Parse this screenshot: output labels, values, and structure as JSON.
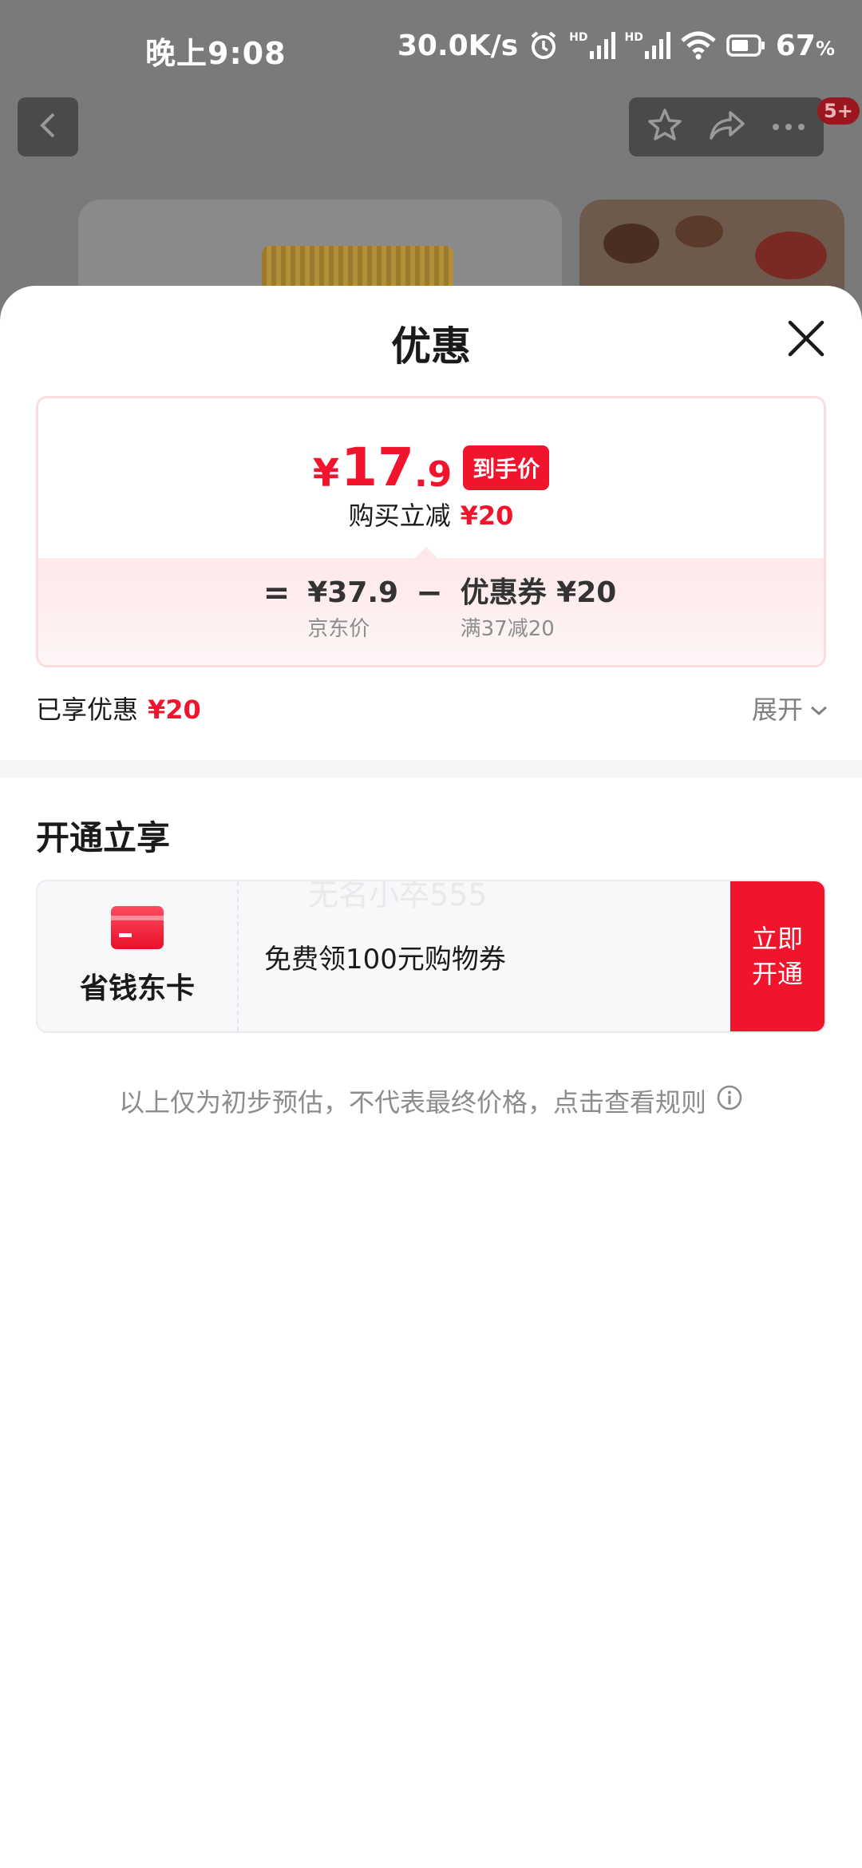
{
  "status_bar": {
    "time": "晚上9:08",
    "network_speed": "30.0K/s",
    "signal_tag_1": "HD",
    "signal_tag_2": "HD",
    "battery_percent": "67",
    "battery_unit": "%",
    "battery_level": 0.67
  },
  "top_nav": {
    "badge": "5+"
  },
  "sheet": {
    "title": "优惠",
    "price_card": {
      "currency": "¥",
      "price_int": "17",
      "price_dec": ".9",
      "final_price_tag": "到手价",
      "discount_label": "购买立减",
      "discount_amount": "¥20",
      "equals": "=",
      "minus": "−",
      "original_price": "¥37.9",
      "original_label": "京东价",
      "coupon_value": "优惠券 ¥20",
      "coupon_condition": "满37减20"
    },
    "enjoyed_label": "已享优惠",
    "enjoyed_amount": "¥20",
    "expand_label": "展开",
    "open_section_title": "开通立享",
    "membership": {
      "name": "省钱东卡",
      "offer": "免费领100元购物券",
      "button_label": "立即开通",
      "watermark": "无名小卒555"
    },
    "disclaimer": "以上仅为初步预估，不代表最终价格，点击查看规则"
  },
  "colors": {
    "accent_red": "#f0142d",
    "card_border": "#fbdde0",
    "muted_text": "#8c8c8c"
  },
  "icons": {
    "back": "chevron-left-icon",
    "favorite": "star-icon",
    "share": "share-icon",
    "more": "more-icon",
    "close": "close-icon",
    "expand": "chevron-down-icon",
    "card": "card-icon",
    "info": "info-icon",
    "alarm": "alarm-icon",
    "signal": "signal-icon",
    "wifi": "wifi-icon",
    "battery": "battery-icon"
  }
}
